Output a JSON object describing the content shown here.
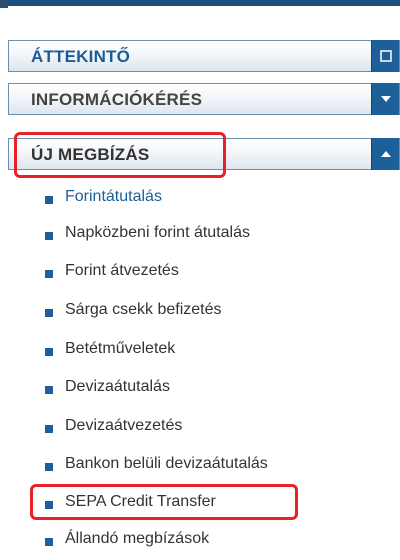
{
  "colors": {
    "accent": "#1d5f98",
    "header_border": "#6d8fae",
    "highlight": "#e8202a",
    "active_text": "#1d5f98",
    "default_text": "#333333"
  },
  "headers": [
    {
      "label": "ÁTTEKINTŐ",
      "toggle_icon": "square-tab-icon"
    },
    {
      "label": "INFORMÁCIÓKÉRÉS",
      "toggle_icon": "chevron-down-icon"
    },
    {
      "label": "ÚJ MEGBÍZÁS",
      "toggle_icon": "chevron-up-icon"
    }
  ],
  "submenu": {
    "items": [
      {
        "label": "Forintátutalás",
        "active": true
      },
      {
        "label": "Napközbeni forint átutalás"
      },
      {
        "label": "Forint átvezetés"
      },
      {
        "label": "Sárga csekk befizetés"
      },
      {
        "label": "Betétműveletek"
      },
      {
        "label": "Devizaátutalás"
      },
      {
        "label": "Devizaátvezetés"
      },
      {
        "label": "Bankon belüli devizaátutalás"
      },
      {
        "label": "SEPA Credit Transfer"
      },
      {
        "label": "Állandó megbízások"
      }
    ]
  }
}
